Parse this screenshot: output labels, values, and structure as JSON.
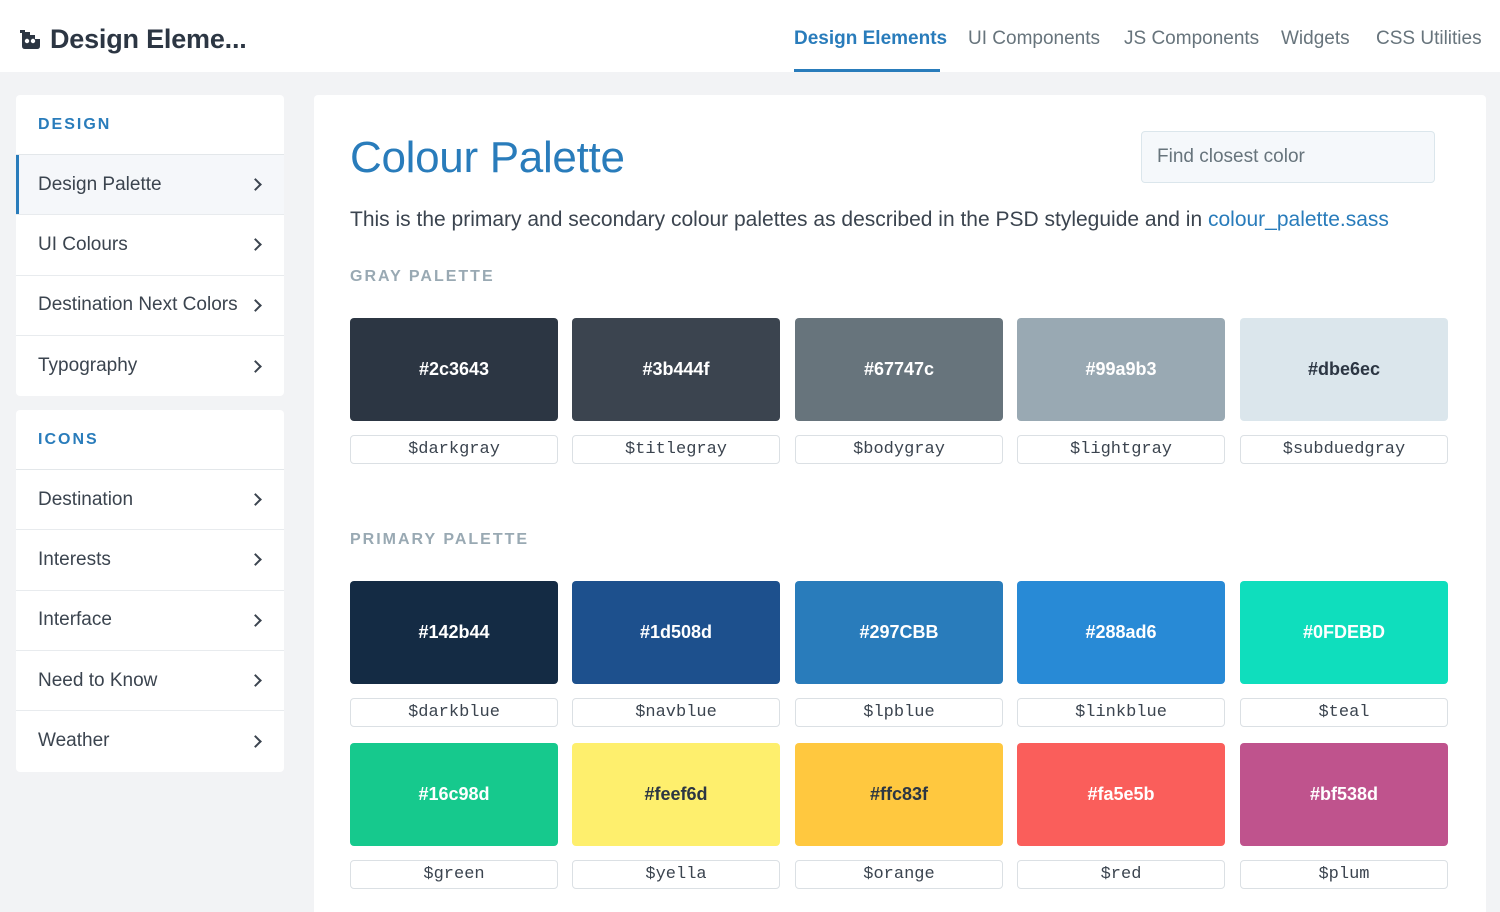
{
  "header": {
    "title": "Design Eleme...",
    "nav": [
      {
        "label": "Design Elements",
        "active": true
      },
      {
        "label": "UI Components",
        "active": false
      },
      {
        "label": "JS Components",
        "active": false
      },
      {
        "label": "Widgets",
        "active": false
      },
      {
        "label": "CSS Utilities",
        "active": false
      }
    ]
  },
  "sidebar": {
    "design": {
      "heading": "DESIGN",
      "items": [
        {
          "label": "Design Palette",
          "active": true
        },
        {
          "label": "UI Colours"
        },
        {
          "label": "Destination Next Colors"
        },
        {
          "label": "Typography"
        }
      ]
    },
    "icons": {
      "heading": "ICONS",
      "items": [
        {
          "label": "Destination"
        },
        {
          "label": "Interests"
        },
        {
          "label": "Interface"
        },
        {
          "label": "Need to Know"
        },
        {
          "label": "Weather"
        }
      ]
    }
  },
  "main": {
    "title": "Colour Palette",
    "search_placeholder": "Find closest color",
    "intro_text": "This is the primary and secondary colour palettes as described in the PSD styleguide and in ",
    "intro_link": "colour_palette.sass",
    "gray_heading": "GRAY PALETTE",
    "primary_heading": "PRIMARY PALETTE",
    "gray": [
      {
        "hex": "#2c3643",
        "var": "$darkgray"
      },
      {
        "hex": "#3b444f",
        "var": "$titlegray"
      },
      {
        "hex": "#67747c",
        "var": "$bodygray"
      },
      {
        "hex": "#99a9b3",
        "var": "$lightgray"
      },
      {
        "hex": "#dbe6ec",
        "var": "$subduedgray"
      }
    ],
    "primary": [
      {
        "hex": "#142b44",
        "var": "$darkblue"
      },
      {
        "hex": "#1d508d",
        "var": "$navblue"
      },
      {
        "hex": "#297CBB",
        "var": "$lpblue"
      },
      {
        "hex": "#288ad6",
        "var": "$linkblue"
      },
      {
        "hex": "#0FDEBD",
        "var": "$teal"
      },
      {
        "hex": "#16c98d",
        "var": "$green"
      },
      {
        "hex": "#feef6d",
        "var": "$yella"
      },
      {
        "hex": "#ffc83f",
        "var": "$orange"
      },
      {
        "hex": "#fa5e5b",
        "var": "$red"
      },
      {
        "hex": "#bf538d",
        "var": "$plum"
      }
    ]
  },
  "colors": {
    "accent": "#297CBB"
  }
}
